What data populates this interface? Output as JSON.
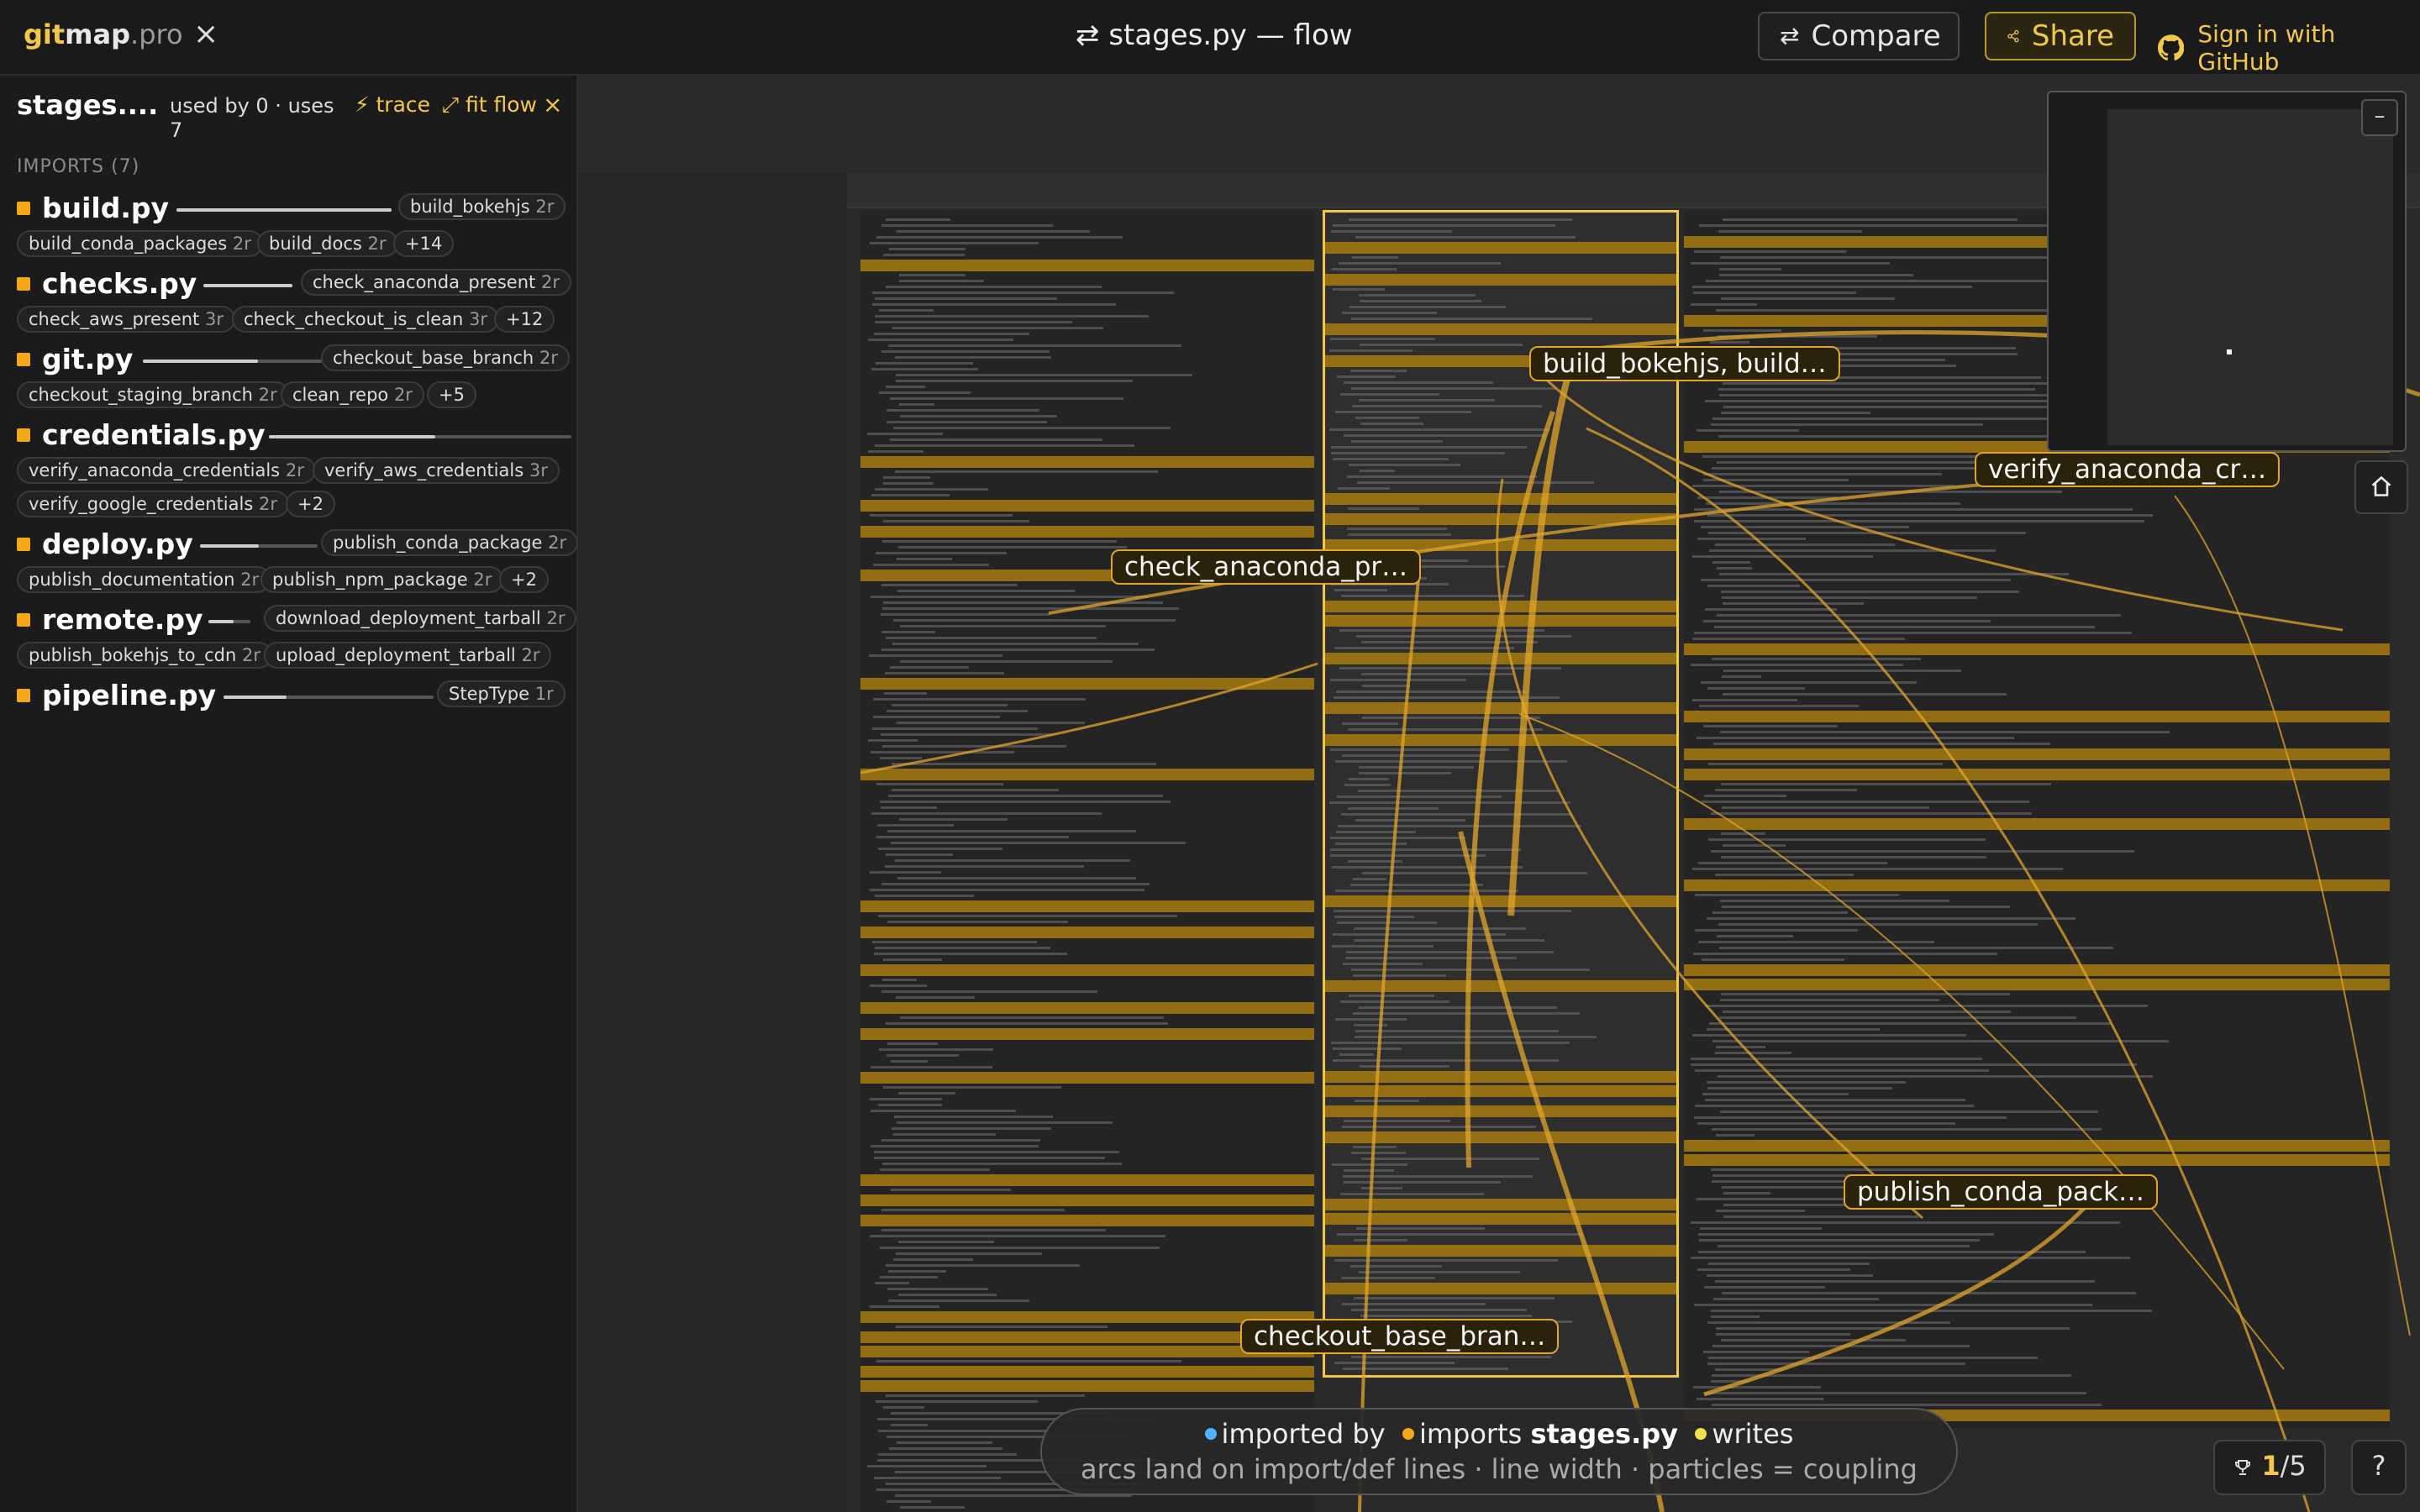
{
  "header": {
    "brand": {
      "part1": "git",
      "part2": "map",
      "part3": ".pro"
    },
    "close_icon": "×",
    "title_icon": "⇄",
    "title": "stages.py — flow",
    "compare": {
      "icon": "⇄",
      "label": "Compare"
    },
    "share": {
      "icon": "share-icon",
      "label": "Share"
    },
    "signin": {
      "icon": "github-icon",
      "label": "Sign in with GitHub"
    }
  },
  "sidebar": {
    "title": "stages....",
    "used": "used by 0 · uses 7",
    "trace": "⚡ trace",
    "fit": "⤢ fit flow",
    "close": "×",
    "imports_header": "IMPORTS (7)",
    "files": [
      {
        "name": "build.py",
        "bar": 0.95,
        "chips": [
          {
            "label": "build_bokehjs",
            "r": "2r"
          },
          {
            "label": "build_conda_packages",
            "r": "2r"
          },
          {
            "label": "build_docs",
            "r": "2r"
          },
          {
            "label": "+14",
            "r": ""
          }
        ]
      },
      {
        "name": "checks.py",
        "bar": 0.95,
        "chips": [
          {
            "label": "check_anaconda_present",
            "r": "2r"
          },
          {
            "label": "check_aws_present",
            "r": "3r"
          },
          {
            "label": "check_checkout_is_clean",
            "r": "3r"
          },
          {
            "label": "+12",
            "r": ""
          }
        ]
      },
      {
        "name": "git.py",
        "bar": 0.6,
        "chips": [
          {
            "label": "checkout_base_branch",
            "r": "2r"
          },
          {
            "label": "checkout_staging_branch",
            "r": "2r"
          },
          {
            "label": "clean_repo",
            "r": "2r"
          },
          {
            "label": "+5",
            "r": ""
          }
        ]
      },
      {
        "name": "credentials.py",
        "bar": 0.55,
        "chips": [
          {
            "label": "verify_anaconda_credentials",
            "r": "2r"
          },
          {
            "label": "verify_aws_credentials",
            "r": "3r"
          },
          {
            "label": "verify_google_credentials",
            "r": "2r"
          },
          {
            "label": "+2",
            "r": ""
          }
        ]
      },
      {
        "name": "deploy.py",
        "bar": 0.5,
        "chips": [
          {
            "label": "publish_conda_package",
            "r": "2r"
          },
          {
            "label": "publish_documentation",
            "r": "2r"
          },
          {
            "label": "publish_npm_package",
            "r": "2r"
          },
          {
            "label": "+2",
            "r": ""
          }
        ]
      },
      {
        "name": "remote.py",
        "bar": 0.6,
        "chips": [
          {
            "label": "download_deployment_tarball",
            "r": "2r"
          },
          {
            "label": "publish_bokehjs_to_cdn",
            "r": "2r"
          },
          {
            "label": "upload_deployment_tarball",
            "r": "2r"
          }
        ]
      },
      {
        "name": "pipeline.py",
        "bar": 0.3,
        "chips": [
          {
            "label": "StepType",
            "r": "1r"
          }
        ]
      }
    ]
  },
  "canvas": {
    "pills": [
      "build_bokehjs, build…",
      "verify_anaconda_cr…",
      "check_anaconda_pr…",
      "publish_conda_pack…",
      "checkout_base_bran…"
    ],
    "minimap_collapse": "–",
    "home_icon": "home-icon"
  },
  "legend": {
    "imported_by": "imported by",
    "imports": "imports",
    "file": "stages.py",
    "writes": "writes",
    "caption": "arcs land on import/def lines · line width · particles = coupling",
    "colors": {
      "imported_by": "#4fb3ff",
      "imports": "#f2a817",
      "writes": "#f2e14b"
    }
  },
  "footer": {
    "counter_icon": "trophy-icon",
    "counter_current": "1",
    "counter_total": "/5",
    "help": "?"
  },
  "colors": {
    "accent": "#f2c84b",
    "arc": "#e0a52b",
    "band": "#b8860b"
  }
}
